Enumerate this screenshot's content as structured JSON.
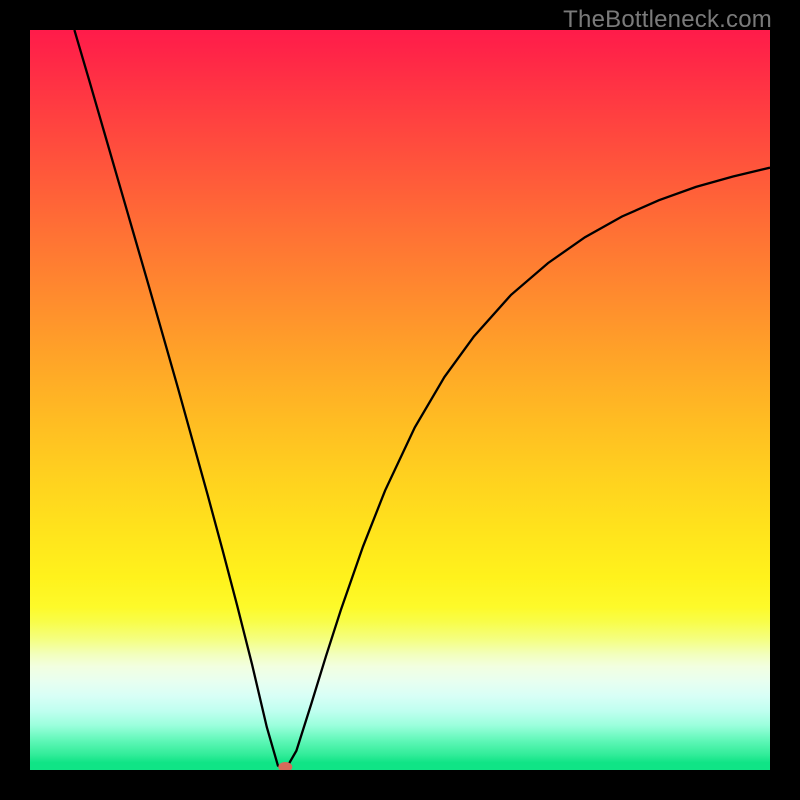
{
  "watermark": "TheBottleneck.com",
  "chart_data": {
    "type": "line",
    "title": "",
    "xlabel": "",
    "ylabel": "",
    "xlim": [
      0,
      100
    ],
    "ylim": [
      0,
      100
    ],
    "series": [
      {
        "name": "left-branch",
        "x": [
          6,
          8,
          10,
          12,
          14,
          16,
          18,
          20,
          22,
          24,
          26,
          28,
          30,
          32,
          33.5,
          34.5
        ],
        "values": [
          100,
          93.2,
          86.3,
          79.4,
          72.5,
          65.6,
          58.6,
          51.6,
          44.4,
          37.2,
          29.8,
          22.2,
          14.3,
          5.8,
          0.6,
          0.0
        ]
      },
      {
        "name": "right-branch",
        "x": [
          34.5,
          36,
          38,
          40,
          42,
          45,
          48,
          52,
          56,
          60,
          65,
          70,
          75,
          80,
          85,
          90,
          95,
          100
        ],
        "values": [
          0.0,
          2.6,
          8.9,
          15.4,
          21.6,
          30.2,
          37.8,
          46.3,
          53.1,
          58.6,
          64.2,
          68.5,
          72.0,
          74.8,
          77.0,
          78.8,
          80.2,
          81.4
        ]
      }
    ],
    "marker": {
      "x": 34.5,
      "y": 0.0,
      "color": "#d76a5a"
    },
    "background_gradient": {
      "top": "#ff1b4a",
      "mid": "#ffd01f",
      "bottom": "#10e486"
    }
  }
}
